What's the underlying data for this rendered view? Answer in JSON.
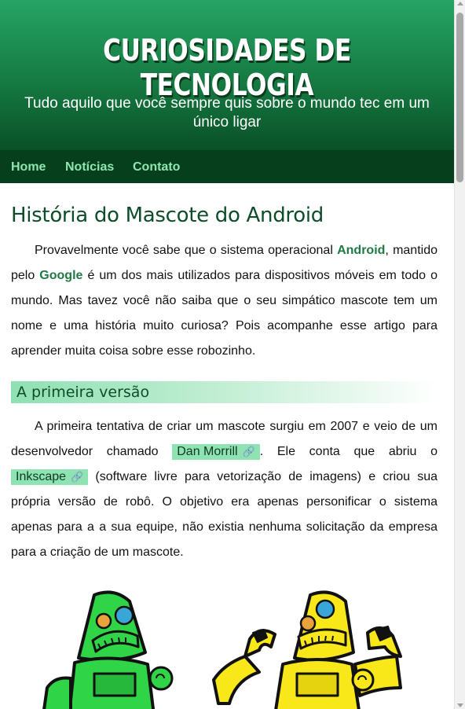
{
  "header": {
    "title": "CURIOSIDADES DE TECNOLOGIA",
    "subtitle": "Tudo aquilo que você sempre quis sobre o mundo tec em um único ligar"
  },
  "nav": {
    "items": [
      {
        "label": "Home"
      },
      {
        "label": "Notícias"
      },
      {
        "label": "Contato"
      }
    ]
  },
  "article": {
    "title": "História do Mascote do Android",
    "intro": {
      "t1": "Provavelmente você sabe que o sistema operacional ",
      "b1": "Android",
      "t2": ", mantido pelo ",
      "b2": "Google",
      "t3": " é um dos mais utilizados para dispositivos móveis em todo o mundo. Mas tavez você não saiba que o seu simpático mascote tem um nome e uma história muito curiosa? Pois acompanhe esse artigo para aprender muita coisa sobre esse robozinho."
    },
    "section1": {
      "heading": "A primeira versão",
      "t1": "A primeira tentativa de criar um mascote surgiu em 2007 e veio de um desenvolvedor chamado ",
      "link1": "Dan Morrill",
      "t2": ". Ele conta que abriu o ",
      "link2": "Inkscape",
      "t3": " (software livre para vetorização de imagens) e criou sua própria versão de robô. O objetivo era apenas personificar o sistema apenas para a a sua equipe, não existia nenhuma solicitação da empresa para a criação de um mascote."
    }
  },
  "icons": {
    "link": "link-icon"
  },
  "colors": {
    "header_top": "#27a465",
    "header_bottom": "#07461f",
    "nav_bg": "#063f1c",
    "nav_text": "#8ee6b1",
    "title_text": "#0d4d2a",
    "link_highlight": "#8fe3b2",
    "robot_green": "#2fd447",
    "robot_yellow": "#f8e81a"
  }
}
